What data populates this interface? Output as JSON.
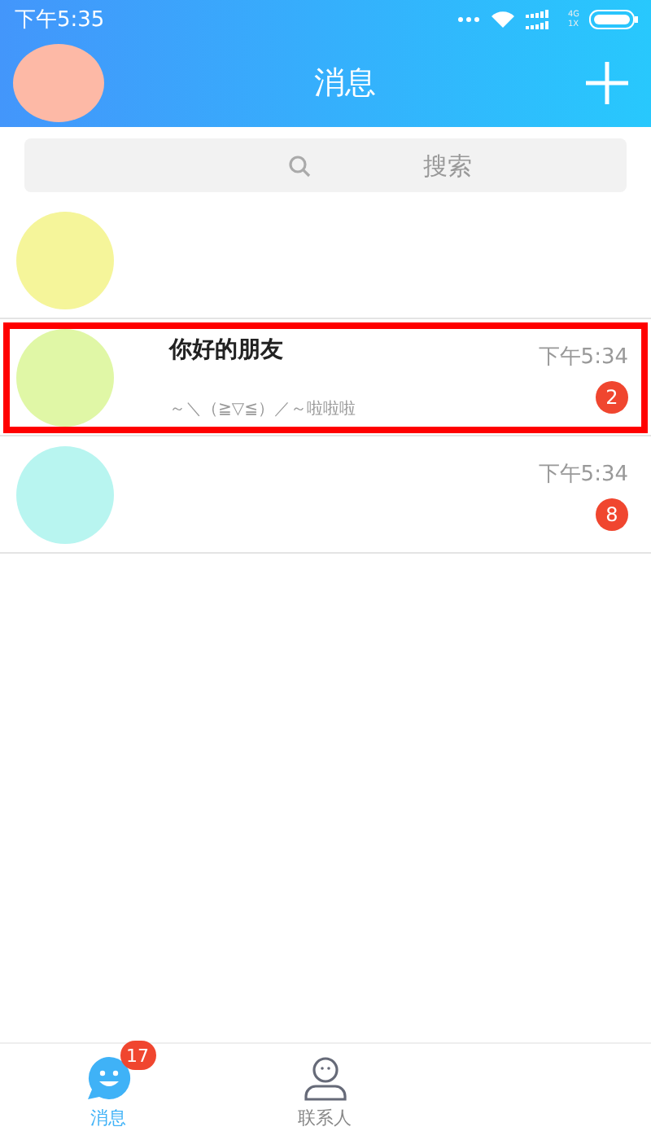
{
  "status_bar": {
    "time": "下午5:35",
    "network": "4G",
    "network_sub": "1X"
  },
  "header": {
    "title": "消息"
  },
  "search": {
    "placeholder": "搜索"
  },
  "conversations": [
    {
      "color": "#f5f59a",
      "highlighted": false
    },
    {
      "color": "#e0f7a6",
      "name": "你好的朋友",
      "preview": "～＼（≧▽≦）／～啦啦啦",
      "time": "下午5:34",
      "badge": "2",
      "highlighted": true
    },
    {
      "color": "#b8f5f0",
      "time": "下午5:34",
      "badge": "8",
      "highlighted": false
    }
  ],
  "tabs": [
    {
      "kind": "chat",
      "label": "消息",
      "badge": "17",
      "selected": true
    },
    {
      "kind": "contacts",
      "label": "联系人",
      "selected": false
    }
  ]
}
